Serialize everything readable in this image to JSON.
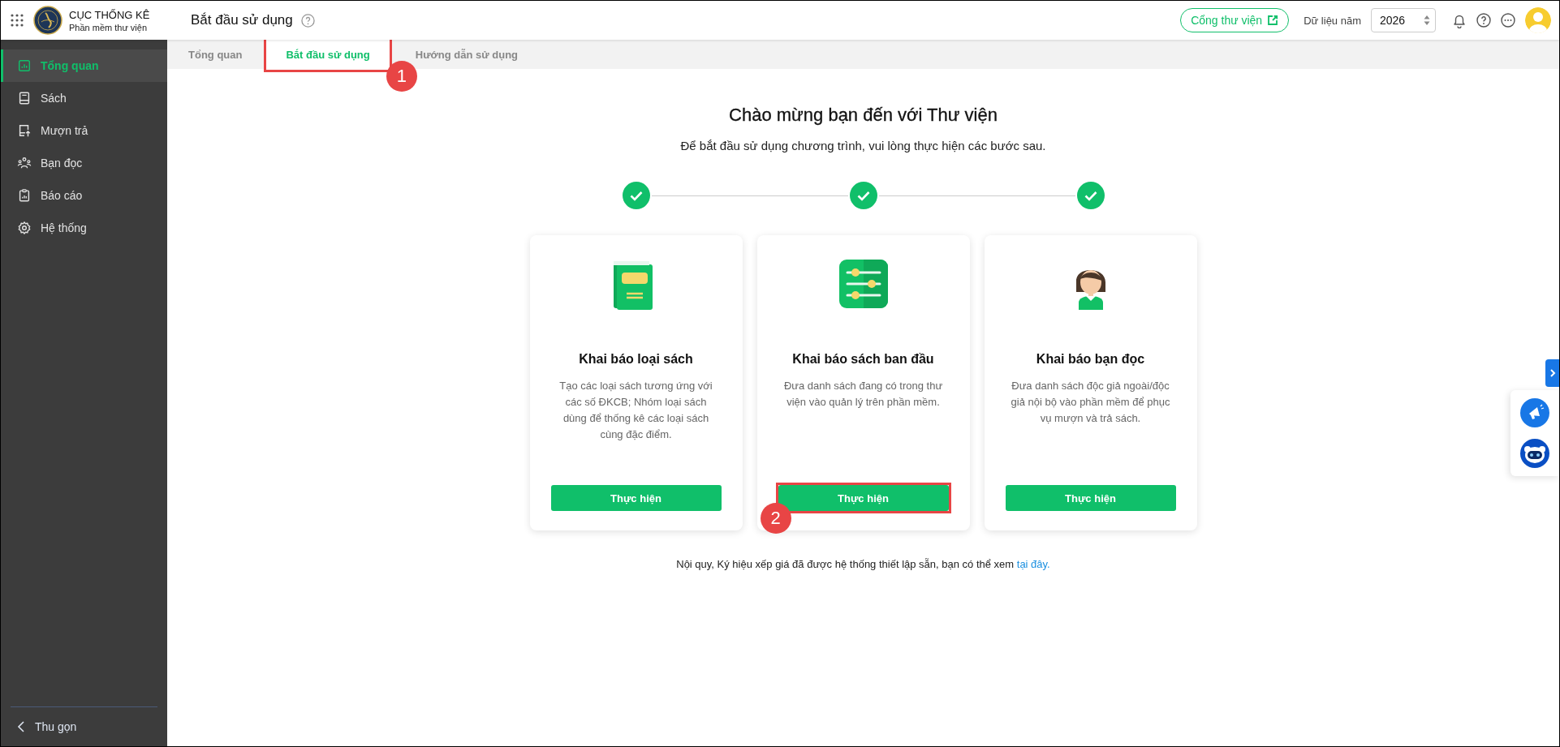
{
  "header": {
    "app_title": "CỤC THỐNG KÊ",
    "app_subtitle": "Phần mềm thư viện",
    "page_title": "Bắt đầu sử dụng",
    "portal_button": "Cổng thư viện",
    "year_label": "Dữ liệu năm",
    "year_value": "2026"
  },
  "sidebar": {
    "items": [
      {
        "label": "Tổng quan",
        "kind": "chart",
        "selected": true
      },
      {
        "label": "Sách",
        "kind": "book",
        "selected": false
      },
      {
        "label": "Mượn trả",
        "kind": "borrow",
        "selected": false
      },
      {
        "label": "Bạn đọc",
        "kind": "people",
        "selected": false
      },
      {
        "label": "Báo cáo",
        "kind": "report",
        "selected": false
      },
      {
        "label": "Hệ thống",
        "kind": "gear",
        "selected": false
      }
    ],
    "collapse": "Thu gọn"
  },
  "tabs": [
    {
      "label": "Tổng quan",
      "selected": false
    },
    {
      "label": "Bắt đầu sử dụng",
      "selected": true,
      "callout": "1"
    },
    {
      "label": "Hướng dẫn sử dụng",
      "selected": false
    }
  ],
  "welcome": {
    "title": "Chào mừng bạn đến với Thư viện",
    "subtitle": "Để bắt đầu sử dụng chương trình, vui lòng thực hiện các bước sau.",
    "steps": [
      {
        "done": true
      },
      {
        "done": true
      },
      {
        "done": true
      }
    ],
    "cards": [
      {
        "kind": "book",
        "title": "Khai báo loại sách",
        "description": "Tạo các loại sách tương ứng với các số ĐKCB; Nhóm loại sách dùng để thống kê các loại sách cùng đặc điểm.",
        "button": "Thực hiện"
      },
      {
        "kind": "sliders",
        "title": "Khai báo sách ban đầu",
        "description": "Đưa danh sách đang có trong thư viện vào quản lý trên phần mềm.",
        "button": "Thực hiện",
        "callout": "2"
      },
      {
        "kind": "person",
        "title": "Khai báo bạn đọc",
        "description": "Đưa danh sách độc giả ngoài/độc giả nội bộ vào phần mềm để phục vụ mượn và trả sách.",
        "button": "Thực hiện"
      }
    ],
    "footer": {
      "text": "Nội quy, Ký hiệu xếp giá đã được hệ thống thiết lập sẵn, bạn có thể xem",
      "link": "tại đây."
    }
  }
}
